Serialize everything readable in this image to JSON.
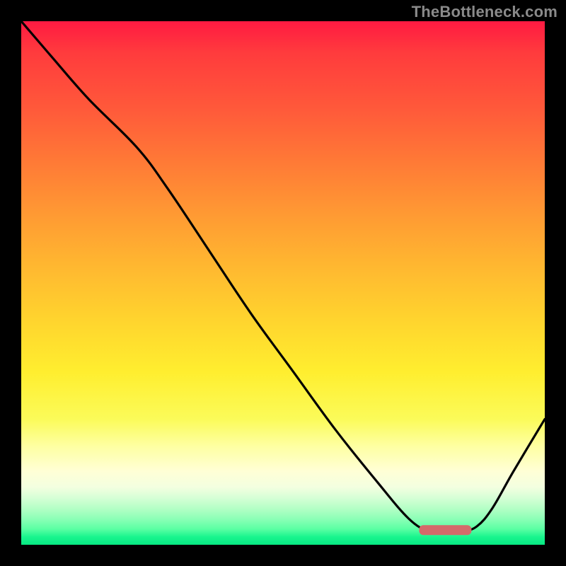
{
  "watermark": "TheBottleneck.com",
  "colors": {
    "frame_bg": "#000000",
    "curve": "#000000",
    "marker": "#d46a6a",
    "watermark": "#8a8a8a",
    "gradient_top": "#ff1a42",
    "gradient_mid": "#ffee2f",
    "gradient_bottom": "#07e882"
  },
  "chart_data": {
    "type": "line",
    "title": "",
    "xlabel": "",
    "ylabel": "",
    "xlim": [
      0,
      100
    ],
    "ylim": [
      0,
      100
    ],
    "grid": false,
    "legend": false,
    "annotations": [
      {
        "kind": "bar-marker",
        "x_start": 76,
        "x_end": 86,
        "y": 2.8,
        "color": "#d46a6a",
        "comment": "flat-minimum highlight"
      }
    ],
    "series": [
      {
        "name": "curve",
        "x": [
          0,
          6,
          13,
          22,
          28,
          36,
          44,
          52,
          60,
          68,
          74,
          78,
          81,
          84,
          87,
          90,
          94,
          100
        ],
        "y": [
          100,
          93,
          85,
          76,
          68,
          56,
          44,
          33,
          22,
          12,
          5,
          2.5,
          2.5,
          2.5,
          3.5,
          7,
          14,
          24
        ]
      }
    ]
  }
}
